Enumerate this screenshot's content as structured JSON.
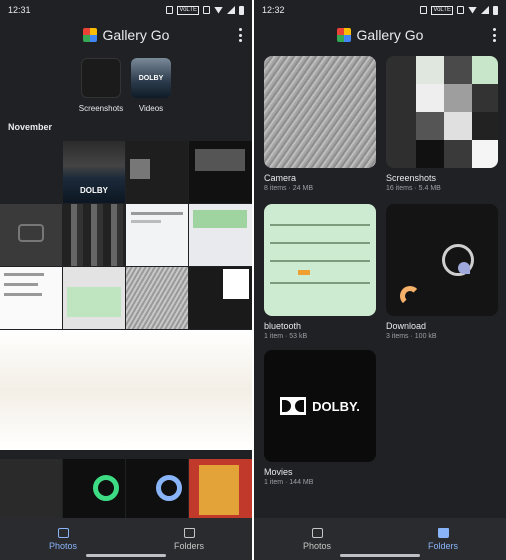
{
  "left_screen": {
    "status_time": "12:31",
    "app_name": "Gallery Go",
    "albums": [
      {
        "label": "Screenshots"
      },
      {
        "label": "Videos"
      }
    ],
    "section_header": "November",
    "dolby_text": "DOLBY",
    "nav": {
      "photos": "Photos",
      "folders": "Folders",
      "active": "photos"
    }
  },
  "right_screen": {
    "status_time": "12:32",
    "app_name": "Gallery Go",
    "folders": [
      {
        "name": "Camera",
        "meta": "8 items · 24 MB"
      },
      {
        "name": "Screenshots",
        "meta": "16 items · 5.4 MB"
      },
      {
        "name": "bluetooth",
        "meta": "1 item · 53 kB"
      },
      {
        "name": "Download",
        "meta": "3 items · 100 kB"
      },
      {
        "name": "Movies",
        "meta": "1 item · 144 MB"
      }
    ],
    "dolby_text": "DOLBY.",
    "nav": {
      "photos": "Photos",
      "folders": "Folders",
      "active": "folders"
    }
  },
  "status_icons": [
    "alarm-icon",
    "volte-icon",
    "vibrate-icon",
    "wifi-icon",
    "signal-icon",
    "battery-icon"
  ],
  "colors": {
    "background": "#202124",
    "accent": "#8ab4f8",
    "text": "#e8eaed",
    "subtext": "#9aa0a6"
  }
}
